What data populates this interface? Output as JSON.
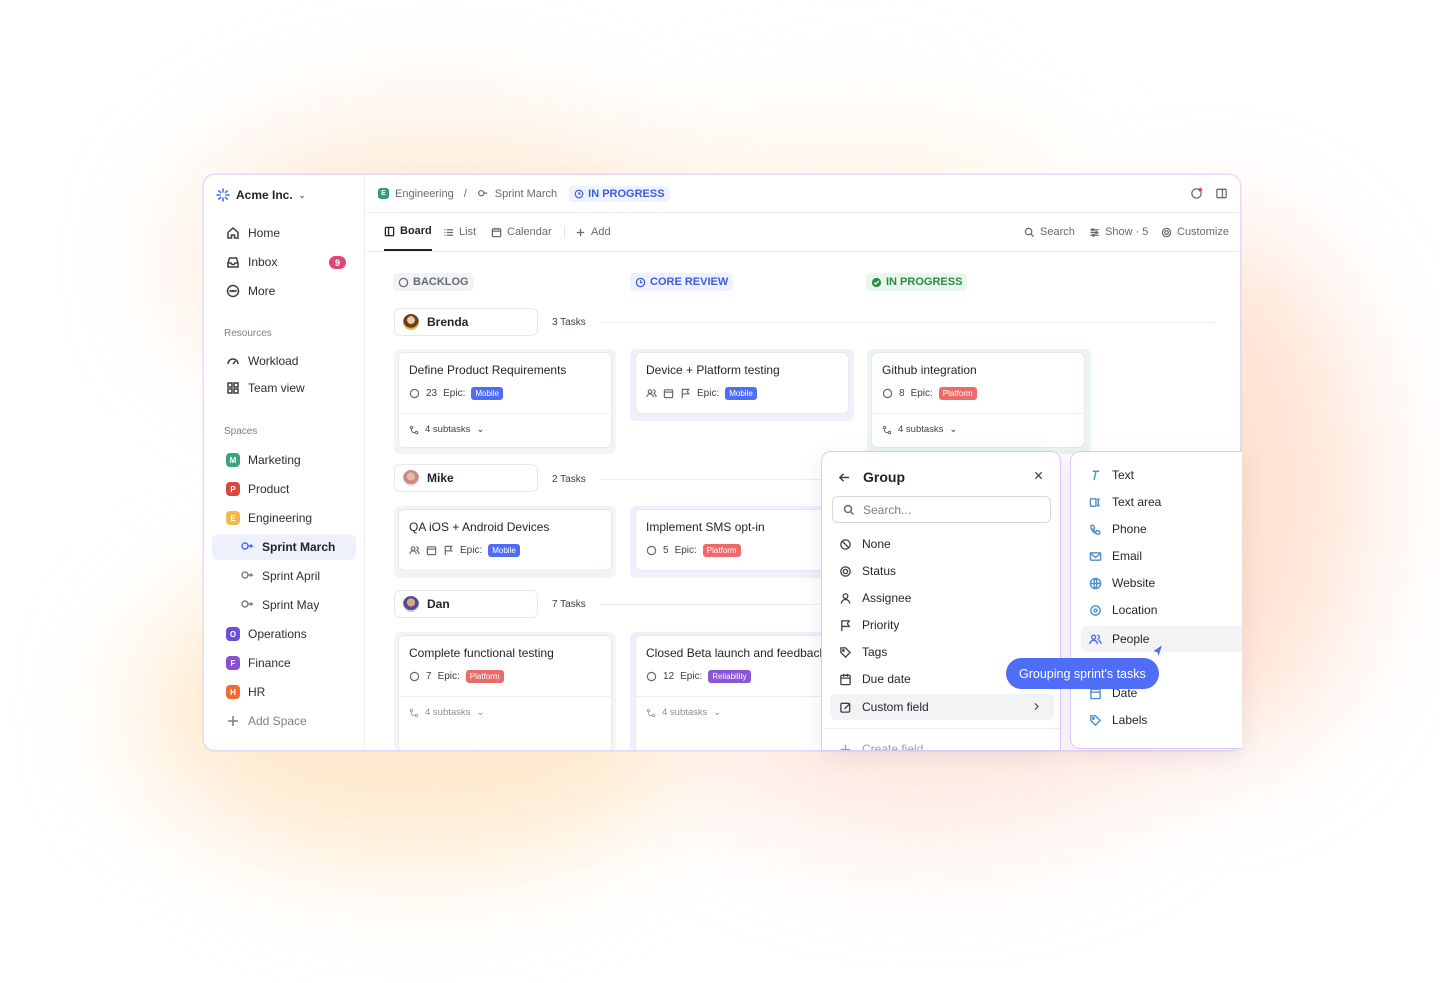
{
  "workspace": {
    "name": "Acme Inc."
  },
  "nav": [
    {
      "label": "Home",
      "icon": "home-icon"
    },
    {
      "label": "Inbox",
      "icon": "inbox-icon",
      "badge": "9"
    },
    {
      "label": "More",
      "icon": "more-icon"
    }
  ],
  "resources": {
    "heading": "Resources",
    "items": [
      {
        "label": "Workload",
        "icon": "gauge-icon"
      },
      {
        "label": "Team view",
        "icon": "grid-icon"
      }
    ]
  },
  "spaces": {
    "heading": "Spaces",
    "items": [
      {
        "label": "Marketing",
        "letter": "M",
        "color": "#3aa57d"
      },
      {
        "label": "Product",
        "letter": "P",
        "color": "#d9473f"
      },
      {
        "label": "Engineering",
        "letter": "E",
        "color": "#f2b94a"
      },
      {
        "label": "Sprint March",
        "sub": true,
        "active": true
      },
      {
        "label": "Sprint April",
        "sub": true
      },
      {
        "label": "Sprint May",
        "sub": true
      },
      {
        "label": "Operations",
        "letter": "O",
        "color": "#6c4fd9"
      },
      {
        "label": "Finance",
        "letter": "F",
        "color": "#8a4fd6"
      },
      {
        "label": "HR",
        "letter": "H",
        "color": "#f06a2f"
      }
    ],
    "add_label": "Add Space"
  },
  "breadcrumb": {
    "space": "Engineering",
    "space_letter": "E",
    "separator": "/",
    "list": "Sprint March",
    "status": "IN PROGRESS"
  },
  "views": {
    "tabs": [
      "Board",
      "List",
      "Calendar"
    ],
    "add": "Add",
    "search": "Search",
    "show": "Show · 5",
    "customize": "Customize"
  },
  "columns": [
    {
      "label": "BACKLOG",
      "color": "#656a73",
      "bg": "#f2f3f5"
    },
    {
      "label": "CORE REVIEW",
      "color": "#3e5cdb",
      "bg": "#eef2ff"
    },
    {
      "label": "IN PROGRESS",
      "color": "#2b8a4a",
      "bg": "#e8f6ec"
    }
  ],
  "groups": [
    {
      "name": "Brenda",
      "count": "3 Tasks"
    },
    {
      "name": "Mike",
      "count": "2 Tasks"
    },
    {
      "name": "Dan",
      "count": "7 Tasks"
    }
  ],
  "cards": {
    "c1": {
      "title": "Define Product Requirements",
      "points": "23",
      "epic": "Epic:",
      "tag": "Mobile",
      "subtasks": "4 subtasks"
    },
    "c2": {
      "title": "Device + Platform testing",
      "epic": "Epic:",
      "tag": "Mobile"
    },
    "c3": {
      "title": "Github integration",
      "points": "8",
      "epic": "Epic:",
      "tag": "Platform",
      "subtasks": "4 subtasks"
    },
    "c4": {
      "title": "QA iOS + Android Devices",
      "epic": "Epic:",
      "tag": "Mobile"
    },
    "c5": {
      "title": "Implement SMS opt-in",
      "points": "5",
      "epic": "Epic:",
      "tag": "Platform"
    },
    "c6": {
      "title": "Complete functional testing",
      "points": "7",
      "epic": "Epic:",
      "tag": "Platform",
      "subtasks": "4 subtasks"
    },
    "c7": {
      "title": "Closed Beta launch and feedback",
      "points": "12",
      "epic": "Epic:",
      "tag": "Reliability",
      "subtasks": "4 subtasks"
    }
  },
  "tag_colors": {
    "Mobile": "#4f6df5",
    "Platform": "#ec6a6a",
    "Reliability": "#8a55d6"
  },
  "group_panel": {
    "title": "Group",
    "search_placeholder": "Search...",
    "options": [
      "None",
      "Status",
      "Assignee",
      "Priority",
      "Tags",
      "Due date",
      "Custom field"
    ],
    "create": "Create field"
  },
  "field_panel": {
    "options": [
      "Text",
      "Text area",
      "Phone",
      "Email",
      "Website",
      "Location",
      "People",
      "Date",
      "Labels"
    ]
  },
  "tooltip": "Grouping sprint's tasks"
}
